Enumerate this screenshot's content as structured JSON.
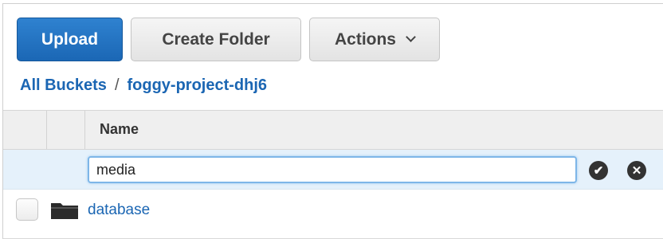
{
  "toolbar": {
    "upload_label": "Upload",
    "create_folder_label": "Create Folder",
    "actions_label": "Actions"
  },
  "breadcrumb": {
    "root": "All Buckets",
    "separator": "/",
    "bucket": "foggy-project-dhj6"
  },
  "table": {
    "column_name": "Name",
    "edit_row": {
      "input_value": "media",
      "confirm_icon": "check-circle-icon",
      "cancel_icon": "x-circle-icon"
    },
    "rows": [
      {
        "type_icon": "folder-icon",
        "name": "database"
      }
    ]
  },
  "colors": {
    "primary": "#1b67b5",
    "link": "#1b66b3",
    "edit_row_bg": "#e5f1fb"
  }
}
